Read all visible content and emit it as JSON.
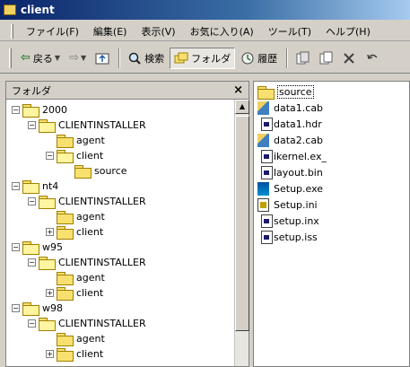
{
  "window": {
    "title": "client"
  },
  "menu": [
    "ファイル(F)",
    "編集(E)",
    "表示(V)",
    "お気に入り(A)",
    "ツール(T)",
    "ヘルプ(H)"
  ],
  "toolbar": {
    "back": "戻る",
    "search": "検索",
    "folders": "フォルダ",
    "history": "履歴"
  },
  "folder_panel": {
    "title": "フォルダ",
    "close": "×",
    "tree": [
      {
        "label": "2000",
        "expander": "−",
        "state": "open"
      },
      {
        "label": "CLIENTINSTALLER",
        "expander": "−",
        "state": "open"
      },
      {
        "label": "agent",
        "expander": "",
        "state": "closed"
      },
      {
        "label": "client",
        "expander": "−",
        "state": "open"
      },
      {
        "label": "source",
        "expander": "",
        "state": "closed"
      },
      {
        "label": "nt4",
        "expander": "−",
        "state": "open"
      },
      {
        "label": "CLIENTINSTALLER",
        "expander": "−",
        "state": "open"
      },
      {
        "label": "agent",
        "expander": "",
        "state": "closed"
      },
      {
        "label": "client",
        "expander": "+",
        "state": "closed"
      },
      {
        "label": "w95",
        "expander": "−",
        "state": "open"
      },
      {
        "label": "CLIENTINSTALLER",
        "expander": "−",
        "state": "open"
      },
      {
        "label": "agent",
        "expander": "",
        "state": "closed"
      },
      {
        "label": "client",
        "expander": "+",
        "state": "closed"
      },
      {
        "label": "w98",
        "expander": "−",
        "state": "open"
      },
      {
        "label": "CLIENTINSTALLER",
        "expander": "−",
        "state": "open"
      },
      {
        "label": "agent",
        "expander": "",
        "state": "closed"
      },
      {
        "label": "client",
        "expander": "+",
        "state": "closed"
      }
    ]
  },
  "files": [
    {
      "name": "source",
      "kind": "folder"
    },
    {
      "name": "data1.cab",
      "kind": "cab"
    },
    {
      "name": "data1.hdr",
      "kind": "file"
    },
    {
      "name": "data2.cab",
      "kind": "cab"
    },
    {
      "name": "ikernel.ex_",
      "kind": "file"
    },
    {
      "name": "layout.bin",
      "kind": "file"
    },
    {
      "name": "Setup.exe",
      "kind": "exe"
    },
    {
      "name": "Setup.ini",
      "kind": "ini"
    },
    {
      "name": "setup.inx",
      "kind": "file"
    },
    {
      "name": "setup.iss",
      "kind": "file"
    }
  ]
}
